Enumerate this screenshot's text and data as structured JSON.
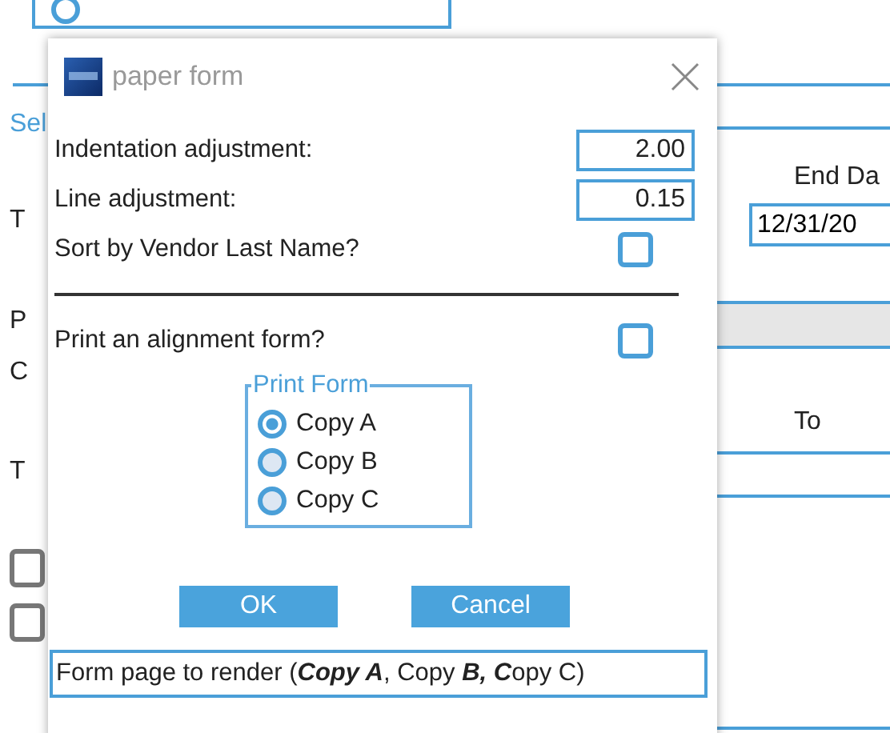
{
  "background": {
    "top_option": {
      "selected": false
    },
    "left_labels": [
      "Sel",
      "T",
      "P",
      "C",
      "T"
    ],
    "end_date_label": "End Da",
    "end_date_value": "12/31/20",
    "to_label": "To",
    "checkboxes": [
      {
        "checked": false
      },
      {
        "checked": false
      }
    ]
  },
  "dialog": {
    "title": "paper form",
    "fields": [
      {
        "label": "Indentation adjustment:",
        "value": "2.00"
      },
      {
        "label": "Line adjustment:",
        "value": "0.15"
      }
    ],
    "sort_option": {
      "label": "Sort by Vendor Last Name?",
      "checked": false
    },
    "alignment_option": {
      "label": "Print an alignment form?",
      "checked": false
    },
    "print_form": {
      "legend": "Print Form",
      "options": [
        {
          "label": "Copy A",
          "selected": true
        },
        {
          "label": "Copy B",
          "selected": false
        },
        {
          "label": "Copy C",
          "selected": false
        }
      ]
    },
    "buttons": [
      "OK",
      "Cancel"
    ],
    "status": "Form page to render (**Copy A**, Copy **B,** **C**opy C)"
  }
}
